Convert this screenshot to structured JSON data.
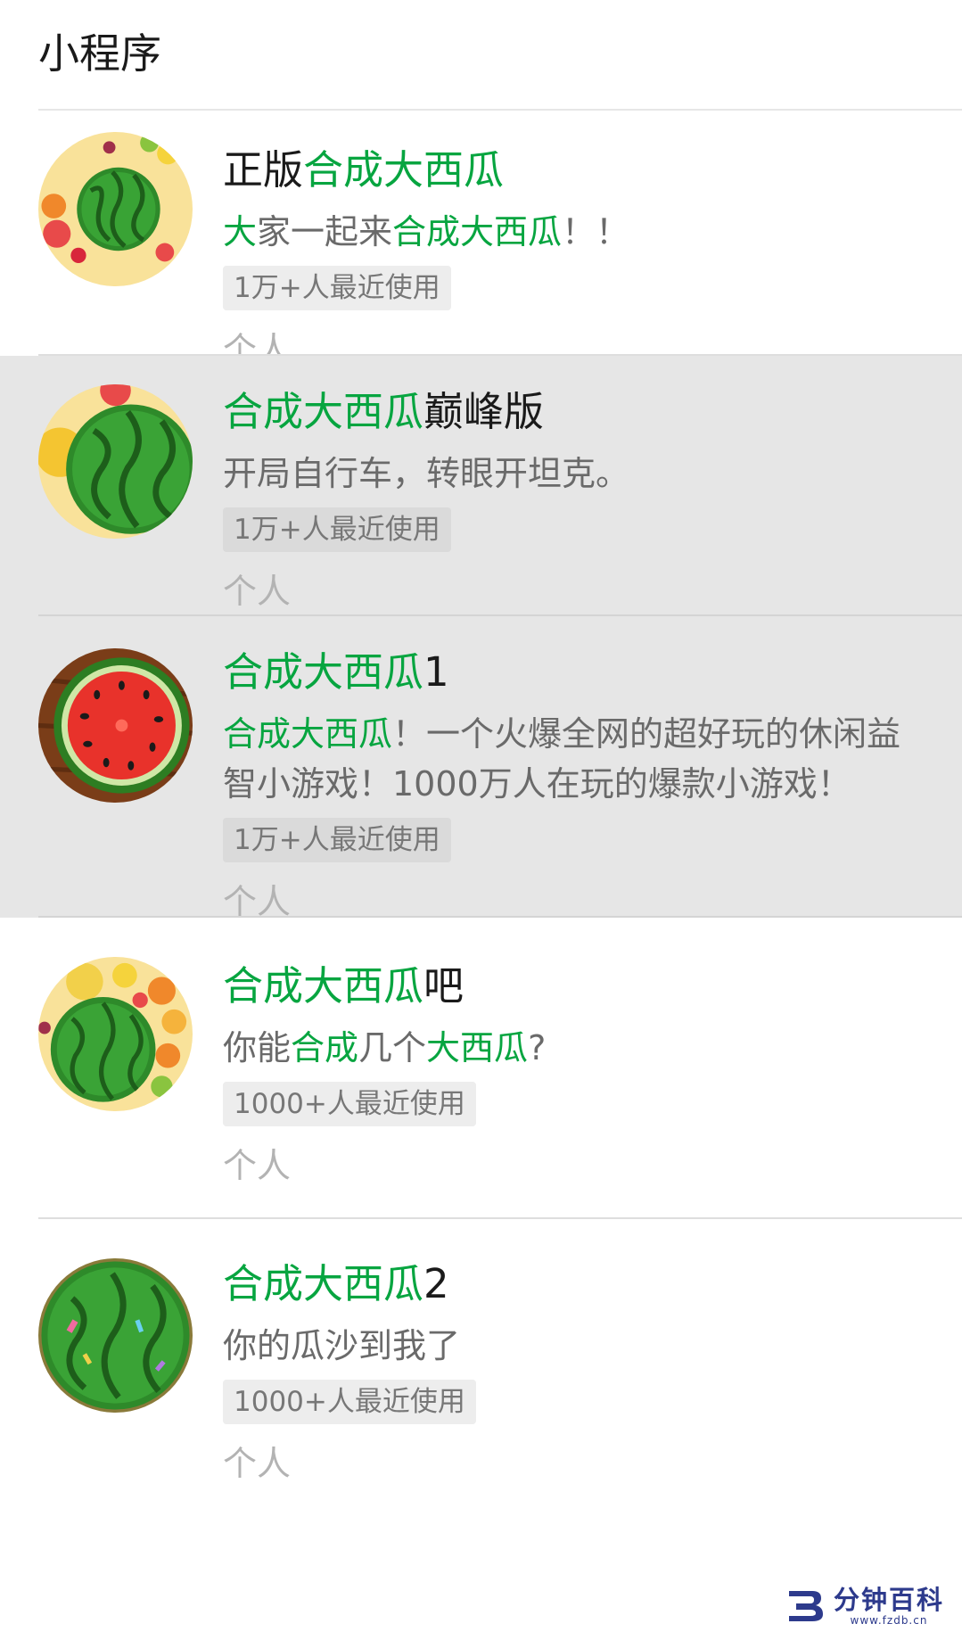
{
  "section": {
    "title": "小程序"
  },
  "items": [
    {
      "title_parts": [
        {
          "text": "正版",
          "highlight": false
        },
        {
          "text": "合成大西瓜",
          "highlight": true
        }
      ],
      "desc_parts": [
        {
          "text": "大",
          "highlight": true
        },
        {
          "text": "家一起来",
          "highlight": false
        },
        {
          "text": "合成大西瓜",
          "highlight": true
        },
        {
          "text": "！！",
          "highlight": false
        }
      ],
      "usage": "1万+人最近使用",
      "owner": "个人",
      "icon": "watermelon-fruit-mix-icon"
    },
    {
      "title_parts": [
        {
          "text": "合成大西瓜",
          "highlight": true
        },
        {
          "text": "巅峰版",
          "highlight": false
        }
      ],
      "desc_parts": [
        {
          "text": "开局自行车，转眼开坦克。",
          "highlight": false
        }
      ],
      "usage": "1万+人最近使用",
      "owner": "个人",
      "icon": "watermelon-large-icon"
    },
    {
      "title_parts": [
        {
          "text": "合成大西瓜",
          "highlight": true
        },
        {
          "text": "1",
          "highlight": false
        }
      ],
      "desc_parts": [
        {
          "text": "合成大西瓜",
          "highlight": true
        },
        {
          "text": "！一个火爆全网的超好玩的休闲益智小游戏！1000万人在玩的爆款小游戏！",
          "highlight": false
        }
      ],
      "usage": "1万+人最近使用",
      "owner": "个人",
      "icon": "watermelon-slice-icon"
    },
    {
      "title_parts": [
        {
          "text": "合成大西瓜",
          "highlight": true
        },
        {
          "text": "吧",
          "highlight": false
        }
      ],
      "desc_parts": [
        {
          "text": "你能",
          "highlight": false
        },
        {
          "text": "合成",
          "highlight": true
        },
        {
          "text": "几个",
          "highlight": false
        },
        {
          "text": "大西瓜",
          "highlight": true
        },
        {
          "text": "?",
          "highlight": false
        }
      ],
      "usage": "1000+人最近使用",
      "owner": "个人",
      "icon": "watermelon-fruit-circle-icon"
    },
    {
      "title_parts": [
        {
          "text": "合成大西瓜",
          "highlight": true
        },
        {
          "text": "2",
          "highlight": false
        }
      ],
      "desc_parts": [
        {
          "text": "你的瓜沙到我了",
          "highlight": false
        }
      ],
      "usage": "1000+人最近使用",
      "owner": "个人",
      "icon": "watermelon-confetti-icon"
    }
  ],
  "watermark": {
    "title": "分钟百科",
    "url": "www.fzdb.cn"
  },
  "colors": {
    "highlight": "#07a540",
    "selected_bg": "#e6e6e6",
    "usage_bg": "#ededed",
    "owner_text": "#b3b3b3"
  }
}
